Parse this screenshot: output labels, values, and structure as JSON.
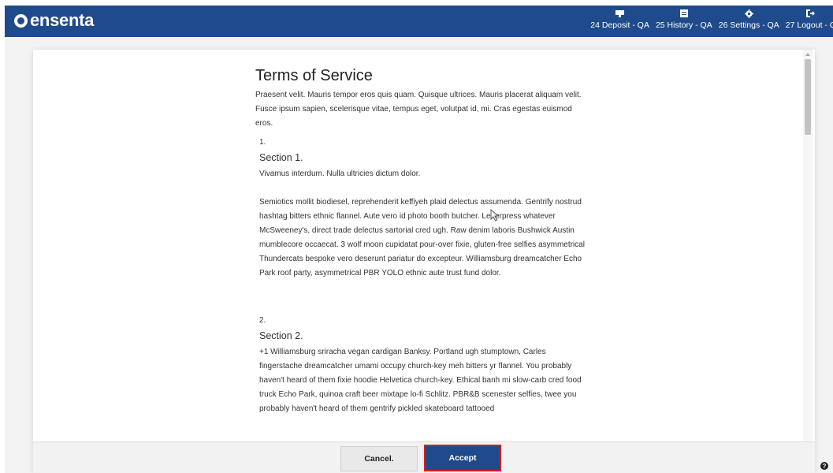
{
  "brand": {
    "name": "ensenta"
  },
  "nav": [
    {
      "label": "24 Deposit - QA",
      "icon": "deposit-icon"
    },
    {
      "label": "25 History - QA",
      "icon": "history-icon"
    },
    {
      "label": "26 Settings - QA",
      "icon": "gear-icon"
    },
    {
      "label": "27 Logout - Q",
      "icon": "logout-icon"
    }
  ],
  "doc": {
    "title": "Terms of Service",
    "intro": "Praesent velit. Mauris tempor eros quis quam. Quisque ultrices. Mauris placerat aliquam velit. Fusce ipsum sapien, scelerisque vitae, tempus eget, volutpat id, mi. Cras egestas euismod eros.",
    "sections": [
      {
        "number": "1.",
        "title": "Section 1.",
        "p1": "Vivamus interdum. Nulla ultricies dictum dolor.",
        "p2": "Semiotics mollit biodiesel, reprehenderit keffiyeh plaid delectus assumenda. Gentrify nostrud hashtag bitters ethnic flannel. Aute vero id photo booth butcher. Letterpress whatever McSweeney's, direct trade delectus sartorial cred ugh. Raw denim laboris Bushwick Austin mumblecore occaecat. 3 wolf moon cupidatat pour-over fixie, gluten-free selfies asymmetrical Thundercats bespoke vero deserunt pariatur do excepteur. Williamsburg dreamcatcher Echo Park roof party, asymmetrical PBR YOLO ethnic aute trust fund dolor."
      },
      {
        "number": "2.",
        "title": "Section 2.",
        "p1": "+1 Williamsburg sriracha vegan cardigan Banksy. Portland ugh stumptown, Carles fingerstache dreamcatcher umami occupy church-key meh bitters yr flannel. You probably haven't heard of them fixie hoodie Helvetica church-key. Ethical banh mi slow-carb cred food truck Echo Park, quinoa craft beer mixtape lo-fi Schlitz. PBR&B scenester selfies, twee you probably haven't heard of them gentrify pickled skateboard tattooed"
      }
    ]
  },
  "footer": {
    "cancel_label": "Cancel.",
    "accept_label": "Accept"
  },
  "help": {
    "glyph": "?"
  },
  "colors": {
    "header": "#1f4b8c",
    "accept_outline": "#d0201e"
  }
}
